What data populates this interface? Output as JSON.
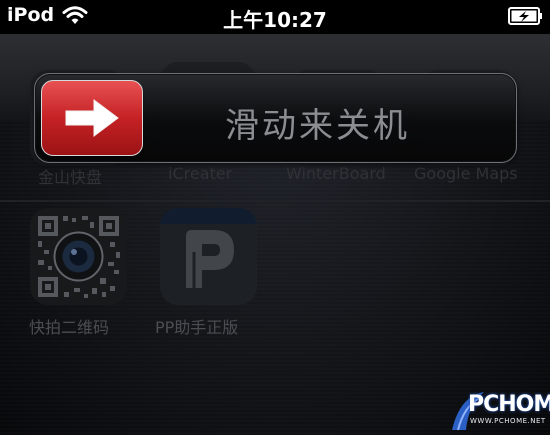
{
  "status_bar": {
    "carrier": "iPod",
    "time": "上午10:27",
    "wifi_icon": "wifi-icon",
    "battery_icon": "battery-charging-icon"
  },
  "power_off_slider": {
    "label": "滑动来关机",
    "thumb_icon": "arrow-right-icon",
    "thumb_color": "#c52225"
  },
  "home_screen": {
    "row1_apps": [
      "金山快盘",
      "iCreater",
      "WinterBoard",
      "Google Maps"
    ],
    "row2_apps": [
      {
        "label": "快拍二维码",
        "icon": "qr-camera-icon"
      },
      {
        "label": "PP助手正版",
        "icon": "pp-assistant-icon"
      }
    ]
  },
  "watermark": {
    "brand": "PCHOME",
    "url": "WWW.PCHOME.NET"
  }
}
